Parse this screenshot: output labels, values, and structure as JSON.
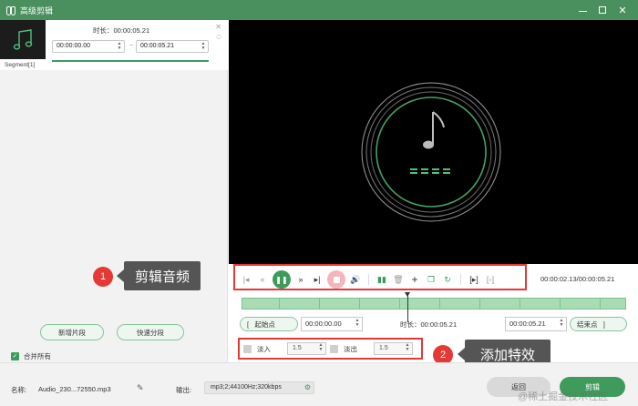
{
  "window": {
    "title": "高级剪辑"
  },
  "segment": {
    "label": "Segment[1]",
    "duration_label": "时长：",
    "duration": "00:00:05.21",
    "start": "00:00:00.00",
    "end": "00:00:05.21",
    "separator": "~"
  },
  "left_buttons": {
    "add_segment": "新增片段",
    "quick_split": "快速分段"
  },
  "merge": {
    "label": "合并所有",
    "checked": true
  },
  "preview": {
    "icon": "music-note-icon"
  },
  "playback": {
    "time": "00:00:02.13/00:00:05.21"
  },
  "trim": {
    "start_btn": "起始点",
    "start_value": "00:00:00.00",
    "duration_label": "时长：",
    "duration": "00:00:05.21",
    "end_value": "00:00:05.21",
    "end_btn": "结束点"
  },
  "effects": {
    "fade_in_label": "淡入",
    "fade_in_value": "1.5",
    "fade_out_label": "淡出",
    "fade_out_value": "1.5"
  },
  "annotations": {
    "one": {
      "num": "1",
      "text": "剪辑音频"
    },
    "two": {
      "num": "2",
      "text": "添加特效"
    }
  },
  "bottom": {
    "name_label": "名称:",
    "name_value": "Audio_230...72550.mp3",
    "output_label": "输出:",
    "output_value": "mp3;2;44100Hz;320kbps",
    "return_btn": "返回",
    "cut_btn": "剪辑",
    "watermark": "@稀土掘金技术社区"
  },
  "colors": {
    "accent": "#3e9b5c",
    "titlebar": "#4a8f5e",
    "annotation_red": "#e53935"
  }
}
